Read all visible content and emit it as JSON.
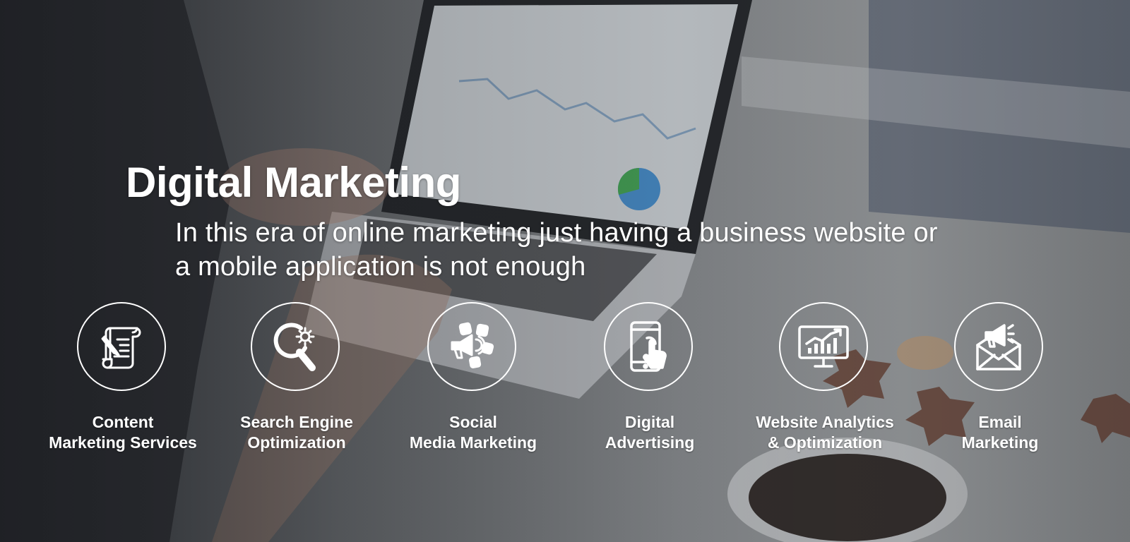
{
  "hero": {
    "title": "Digital Marketing",
    "subtitle": "In this era of online marketing just having a business website or a mobile application is not enough"
  },
  "services": [
    {
      "line1": "Content",
      "line2": "Marketing Services",
      "icon": "scroll-pen-icon"
    },
    {
      "line1": "Search Engine",
      "line2": "Optimization",
      "icon": "magnifier-gear-icon"
    },
    {
      "line1": "Social",
      "line2": "Media Marketing",
      "icon": "megaphone-social-icon"
    },
    {
      "line1": "Digital",
      "line2": "Advertising",
      "icon": "tablet-touch-icon"
    },
    {
      "line1": "Website Analytics",
      "line2": "& Optimization",
      "icon": "monitor-chart-icon"
    },
    {
      "line1": "Email",
      "line2": "Marketing",
      "icon": "envelope-megaphone-icon"
    }
  ],
  "colors": {
    "text": "#ffffff",
    "icon_stroke": "#ffffff"
  }
}
